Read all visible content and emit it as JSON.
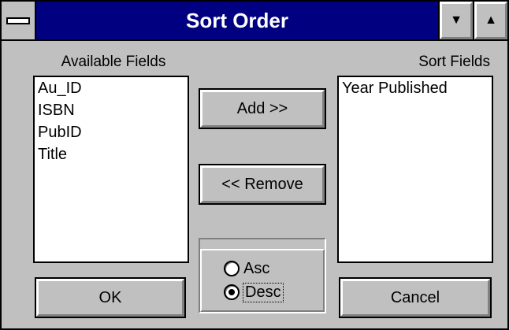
{
  "window": {
    "title": "Sort Order"
  },
  "titlebar": {
    "minimize_glyph": "▼",
    "maximize_glyph": "▲"
  },
  "available": {
    "label": "Available Fields",
    "items": [
      "Au_ID",
      "ISBN",
      "PubID",
      "Title"
    ]
  },
  "sort": {
    "label": "Sort Fields",
    "items": [
      "Year Published"
    ]
  },
  "buttons": {
    "add": "Add >>",
    "remove": "<< Remove",
    "ok": "OK",
    "cancel": "Cancel"
  },
  "order": {
    "asc_label": "Asc",
    "desc_label": "Desc",
    "selected": "Desc"
  }
}
